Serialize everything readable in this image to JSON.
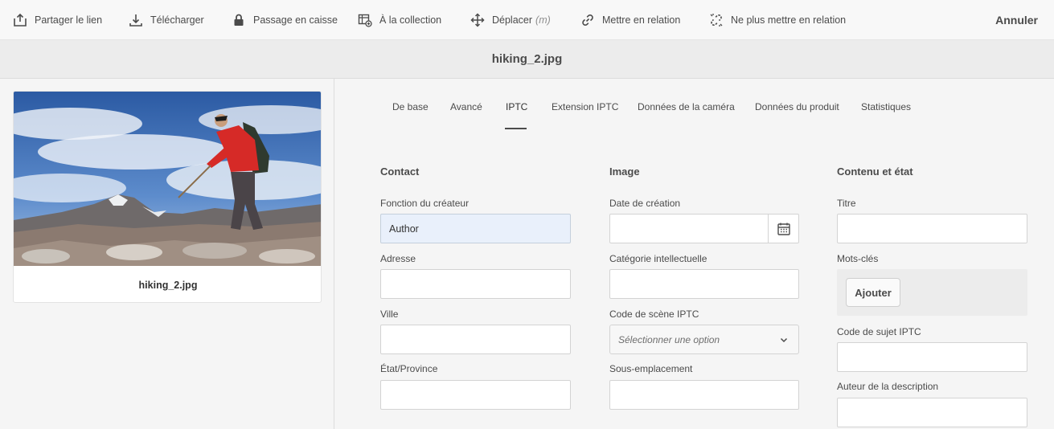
{
  "toolbar": {
    "items": [
      {
        "label": "Partager le lien",
        "icon": "share-icon"
      },
      {
        "label": "Télécharger",
        "icon": "download-icon"
      },
      {
        "label": "Passage en caisse",
        "icon": "lock-icon"
      },
      {
        "label": "À la collection",
        "icon": "collection-add-icon"
      },
      {
        "label": "Déplacer",
        "shortcut": "(m)",
        "icon": "move-icon"
      },
      {
        "label": "Mettre en relation",
        "icon": "link-icon"
      },
      {
        "label": "Ne plus mettre en relation",
        "icon": "unlink-icon"
      }
    ],
    "cancel_label": "Annuler"
  },
  "page": {
    "title": "hiking_2.jpg"
  },
  "asset_card": {
    "name": "hiking_2.jpg"
  },
  "tabs": [
    {
      "label": "De base"
    },
    {
      "label": "Avancé"
    },
    {
      "label": "IPTC",
      "active": true
    },
    {
      "label": "Extension IPTC"
    },
    {
      "label": "Données de la caméra"
    },
    {
      "label": "Données du produit"
    },
    {
      "label": "Statistiques"
    }
  ],
  "columns": {
    "contact": {
      "heading": "Contact",
      "fields": [
        {
          "label": "Fonction du créateur",
          "value": "Author"
        },
        {
          "label": "Adresse",
          "value": ""
        },
        {
          "label": "Ville",
          "value": ""
        },
        {
          "label": "État/Province",
          "value": ""
        }
      ]
    },
    "image": {
      "heading": "Image",
      "fields": [
        {
          "label": "Date de création",
          "value": ""
        },
        {
          "label": "Catégorie intellectuelle",
          "value": ""
        },
        {
          "label": "Code de scène IPTC",
          "placeholder": "Sélectionner une option"
        },
        {
          "label": "Sous-emplacement",
          "value": ""
        }
      ]
    },
    "content": {
      "heading": "Contenu et état",
      "fields": [
        {
          "label": "Titre",
          "value": ""
        },
        {
          "label": "Mots-clés",
          "button": "Ajouter"
        },
        {
          "label": "Code de sujet IPTC",
          "value": ""
        },
        {
          "label": "Auteur de la description",
          "value": ""
        }
      ]
    }
  }
}
